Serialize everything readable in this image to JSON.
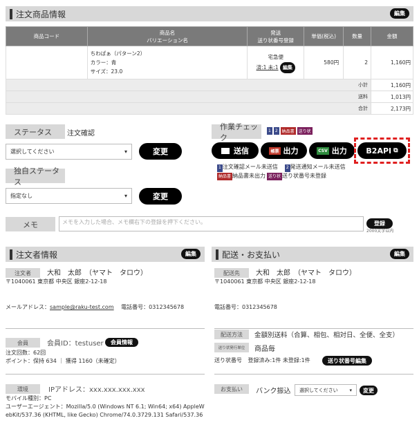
{
  "order_items": {
    "title": "注文商品情報",
    "edit_label": "編集",
    "headers": {
      "code": "商品コード",
      "name_l1": "商品名",
      "name_l2": "バリエーション名",
      "ship_l1": "発送",
      "ship_l2": "送り状番号登録",
      "price": "単価(税込)",
      "qty": "数量",
      "amount": "金額"
    },
    "row": {
      "name": "ちわぱぁ（パターン2）",
      "color": "カラー：青",
      "size": "サイズ：23.0",
      "ship_status": "宅急便",
      "ship_sub": "済:1 未:1",
      "ship_btn": "編集",
      "price": "580円",
      "qty": "2",
      "amount": "1,160円"
    },
    "totals": [
      {
        "label": "小計",
        "value": "1,160円"
      },
      {
        "label": "送料",
        "value": "1,013円"
      },
      {
        "label": "合計",
        "value": "2,173円"
      }
    ]
  },
  "status": {
    "label": "ステータス",
    "value": "注文確認",
    "select_value": "選択してください",
    "change_label": "変更"
  },
  "own_status": {
    "label": "独自ステータス",
    "select_value": "指定なし",
    "change_label": "変更"
  },
  "work_check": {
    "label": "作業チェック",
    "icons": [
      "1",
      "2",
      "納品書",
      "送り状"
    ],
    "send_label": "送信",
    "print_label": "出力",
    "print_tag": "帳票",
    "csv_label": "出力",
    "csv_tag": "CSV",
    "b2api_label": "B2API",
    "legend": [
      {
        "tag": "1",
        "text": "注文確認メール未送信"
      },
      {
        "tag": "2",
        "text": "発送通知メール未送信"
      },
      {
        "tag": "納品書",
        "text": "納品書未出力"
      },
      {
        "tag": "送り状",
        "text": "送り状番号未登録"
      }
    ]
  },
  "memo": {
    "label": "メモ",
    "placeholder": "メモを入力した場合、メモ欄右下の登録を押下ください。",
    "register_label": "登録",
    "limit": "2000文字以内"
  },
  "customer": {
    "title": "注文者情報",
    "edit_label": "編集",
    "orderer_tag": "注文者",
    "name": "大和　太郎　（ヤマト　タロウ）",
    "address": "〒1040061 東京都 中央区 銀座2-12-18",
    "email_label": "メールアドレス：",
    "email": "sample@raku-test.com",
    "phone": "電話番号：0312345678",
    "member_tag": "会員",
    "member_id": "会員ID：testuser",
    "member_btn": "会員情報",
    "order_count": "注文回数：62回",
    "points": "ポイント：保持 634 ｜ 獲得 1160（未確定）",
    "env_tag": "環境",
    "ip": "IPアドレス：xxx.xxx.xxx.xxx",
    "mobile": "モバイル種別：PC",
    "ua": "ユーザーエージェント：Mozilla/5.0 (Windows NT 6.1; Win64; x64) AppleWebKit/537.36 (KHTML, like Gecko) Chrome/74.0.3729.131 Safari/537.36"
  },
  "delivery": {
    "title": "配送・お支払い",
    "edit_label": "編集",
    "dest_tag": "配送先",
    "name": "大和　太郎　（ヤマト　タロウ）",
    "address": "〒1040061 東京都 中央区 銀座2-12-18",
    "phone": "電話番号：0312345678",
    "method_tag": "配送方法",
    "method": "金額別送料（合算、相包、相対日、全便、全支）",
    "unit_tag": "送り状発行単位",
    "unit": "商品毎",
    "tracking_label": "送り状番号",
    "tracking_status": "登録済み:1件 未登録:1件",
    "tracking_btn": "送り状番号編集",
    "pay_tag": "お支払い",
    "pay_method": "バンク振込",
    "pay_select": "選択してください",
    "pay_change": "変更"
  }
}
